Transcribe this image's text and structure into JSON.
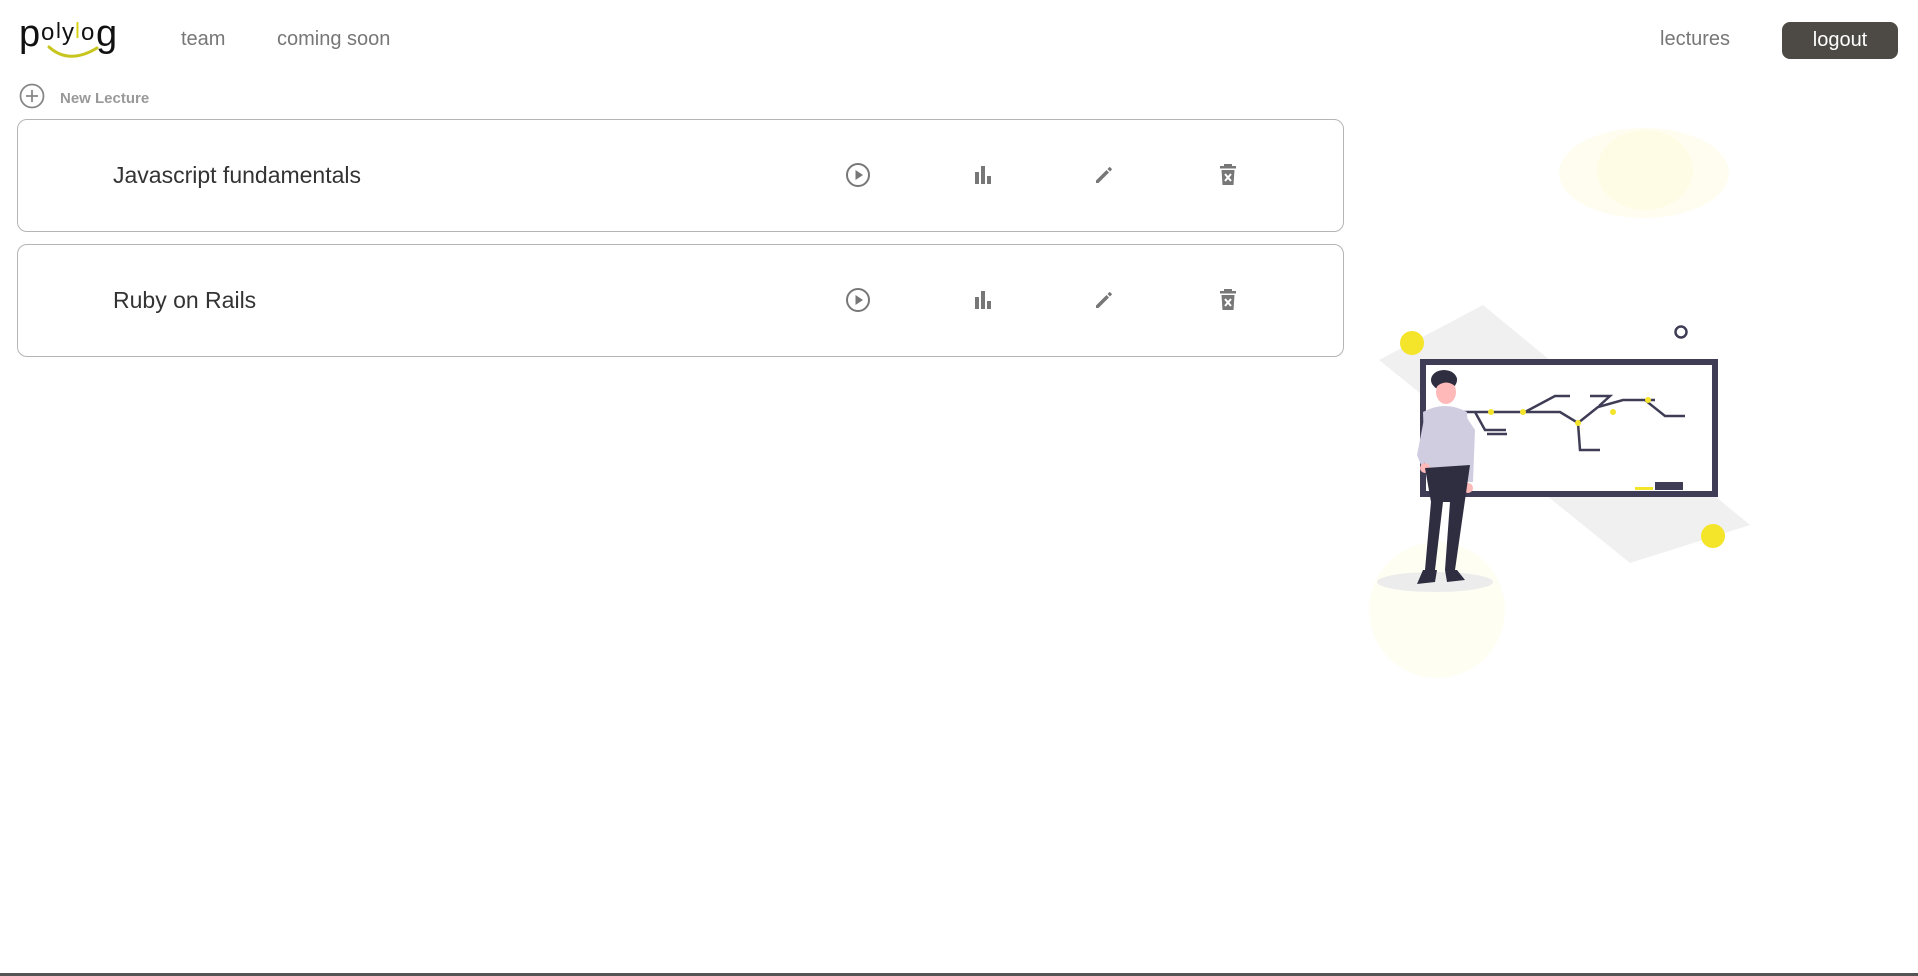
{
  "header": {
    "logo": {
      "text": "polylog",
      "letters": [
        "p",
        "o",
        "l",
        "y",
        "l",
        "o",
        "g"
      ],
      "accent_color": "#c8c51f"
    },
    "nav_left": [
      {
        "label": "team"
      },
      {
        "label": "coming soon"
      }
    ],
    "nav_right": {
      "lectures_label": "lectures",
      "logout_label": "logout"
    }
  },
  "toolbar": {
    "new_lecture_label": "New Lecture",
    "new_lecture_icon": "plus-circle-icon"
  },
  "lectures": [
    {
      "title": "Javascript fundamentals",
      "actions": [
        "play-icon",
        "bar-chart-icon",
        "pencil-icon",
        "trash-icon"
      ]
    },
    {
      "title": "Ruby on Rails",
      "actions": [
        "play-icon",
        "bar-chart-icon",
        "pencil-icon",
        "trash-icon"
      ]
    }
  ],
  "colors": {
    "accent_yellow": "#f4e42a",
    "logout_bg": "#4d4a45",
    "icon_gray": "#777777",
    "board_dark": "#3f3d56",
    "person_shirt": "#d0cde1"
  },
  "illustration": {
    "name": "teacher-at-whiteboard-illustration"
  }
}
